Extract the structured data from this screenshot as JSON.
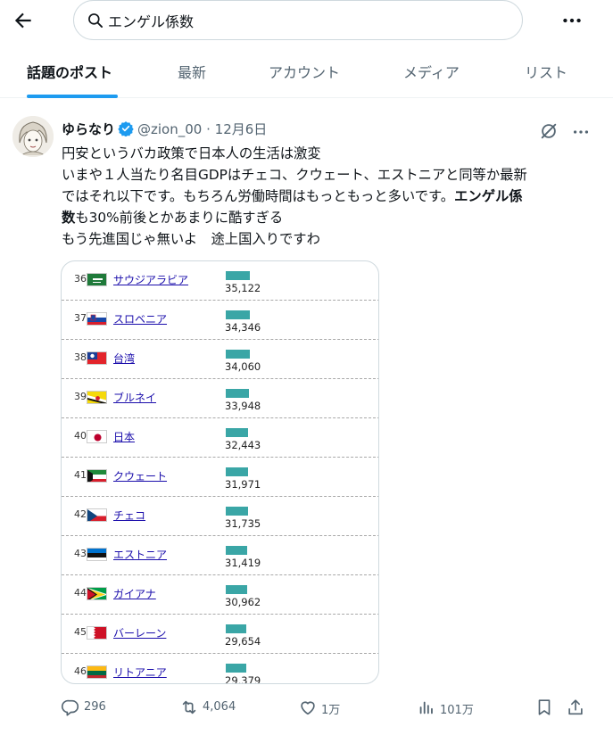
{
  "search": {
    "query": "エンゲル係数"
  },
  "tabs": [
    {
      "label": "話題のポスト",
      "active": true
    },
    {
      "label": "最新",
      "active": false
    },
    {
      "label": "アカウント",
      "active": false
    },
    {
      "label": "メディア",
      "active": false
    },
    {
      "label": "リスト",
      "active": false
    }
  ],
  "tweet": {
    "display_name": "ゆらなり",
    "handle": "@zion_00",
    "date_sep": "·",
    "date": "12月6日",
    "lines": [
      "円安というバカ政策で日本人の生活は激変",
      "いまや１人当たり名目GDPはチェコ、クウェート、エストニアと同等か最新",
      "ではそれ以下です。もちろん労働時間はもっともっと多いです。"
    ],
    "bold_a": "エンゲル係",
    "bold_b": "数",
    "line4_rest": "も30%前後とかあまりに酷すぎる",
    "line5": "もう先進国じゃ無いよ　途上国入りですわ"
  },
  "table_rows": [
    {
      "rank": "36",
      "country": "サウジアラビア",
      "value": "35,122",
      "share": 0.76,
      "flag": "saudi"
    },
    {
      "rank": "37",
      "country": "スロベニア",
      "value": "34,346",
      "share": 0.743,
      "flag": "slovenia"
    },
    {
      "rank": "38",
      "country": "台湾",
      "value": "34,060",
      "share": 0.737,
      "flag": "taiwan"
    },
    {
      "rank": "39",
      "country": "ブルネイ",
      "value": "33,948",
      "share": 0.735,
      "flag": "brunei"
    },
    {
      "rank": "40",
      "country": "日本",
      "value": "32,443",
      "share": 0.702,
      "flag": "japan"
    },
    {
      "rank": "41",
      "country": "クウェート",
      "value": "31,971",
      "share": 0.692,
      "flag": "kuwait"
    },
    {
      "rank": "42",
      "country": "チェコ",
      "value": "31,735",
      "share": 0.687,
      "flag": "czech"
    },
    {
      "rank": "43",
      "country": "エストニア",
      "value": "31,419",
      "share": 0.68,
      "flag": "estonia"
    },
    {
      "rank": "44",
      "country": "ガイアナ",
      "value": "30,962",
      "share": 0.67,
      "flag": "guyana"
    },
    {
      "rank": "45",
      "country": "バーレーン",
      "value": "29,654",
      "share": 0.642,
      "flag": "bahrain"
    },
    {
      "rank": "46",
      "country": "リトアニア",
      "value": "29,379",
      "share": 0.636,
      "flag": "lithuania"
    }
  ],
  "actions": {
    "replies": "296",
    "reposts": "4,064",
    "likes": "1万",
    "views": "101万"
  },
  "colors": {
    "accent": "#1d9bf0",
    "bar": "#3aa6a6",
    "link": "#1a0dab",
    "muted": "#536471"
  }
}
